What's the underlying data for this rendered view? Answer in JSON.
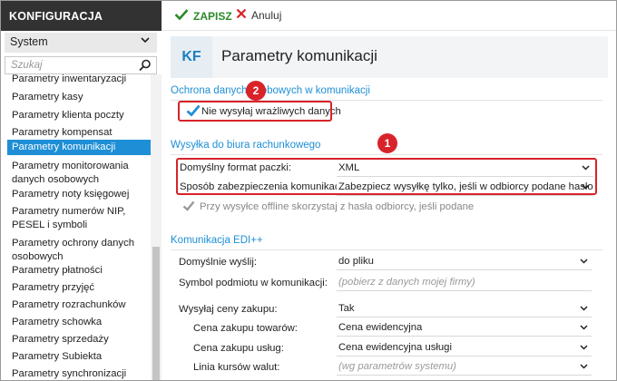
{
  "sidebar": {
    "title": "KONFIGURACJA",
    "module_select": "System",
    "search_placeholder": "Szukaj",
    "items": [
      {
        "label": "Parametry inwentaryzacji"
      },
      {
        "label": "Parametry kasy"
      },
      {
        "label": "Parametry klienta poczty"
      },
      {
        "label": "Parametry kompensat"
      },
      {
        "label": "Parametry komunikacji",
        "active": true
      },
      {
        "label": "Parametry monitorowania danych osobowych"
      },
      {
        "label": "Parametry noty księgowej"
      },
      {
        "label": "Parametry numerów NIP, PESEL i symboli"
      },
      {
        "label": "Parametry ochrony danych osobowych"
      },
      {
        "label": "Parametry płatności"
      },
      {
        "label": "Parametry przyjęć"
      },
      {
        "label": "Parametry rozrachunków"
      },
      {
        "label": "Parametry schowka"
      },
      {
        "label": "Parametry sprzedaży"
      },
      {
        "label": "Parametry Subiekta"
      },
      {
        "label": "Parametry synchronizacji InsERT"
      }
    ]
  },
  "toolbar": {
    "save_label": "ZAPISZ",
    "cancel_label": "Anuluj"
  },
  "header": {
    "badge": "KF",
    "title": "Parametry komunikacji"
  },
  "section_protection": {
    "heading": "Ochrona danych osobowych w komunikacji",
    "checkbox_label": "Nie wysyłaj wrażliwych danych",
    "checked": true
  },
  "section_office": {
    "heading": "Wysyłka do biura rachunkowego",
    "format_label": "Domyślny format paczki:",
    "format_value": "XML",
    "security_label": "Sposób zabezpieczenia komunikacji:",
    "security_value": "Zabezpiecz wysyłkę tylko, jeśli w odbiorcy podane hasło",
    "offline_label": "Przy wysyłce offline skorzystaj z hasła odbiorcy, jeśli podane"
  },
  "section_edi": {
    "heading": "Komunikacja EDI++",
    "send_default_label": "Domyślnie wyślij:",
    "send_default_value": "do pliku",
    "subject_symbol_label": "Symbol podmiotu w komunikacji:",
    "subject_symbol_placeholder": "(pobierz z danych mojej firmy)",
    "send_prices_label": "Wysyłaj ceny zakupu:",
    "send_prices_value": "Tak",
    "goods_price_label": "Cena zakupu towarów:",
    "goods_price_value": "Cena ewidencyjna",
    "services_price_label": "Cena zakupu usług:",
    "services_price_value": "Cena ewidencyjna usługi",
    "fx_line_label": "Linia kursów walut:",
    "fx_line_placeholder": "(wg parametrów systemu)"
  },
  "annotations": {
    "badge_1": "1",
    "badge_2": "2"
  },
  "colors": {
    "accent": "#1e8fd6",
    "highlight": "#d8232a",
    "save_green": "#2a8a2a",
    "sidebar_header": "#323232"
  }
}
